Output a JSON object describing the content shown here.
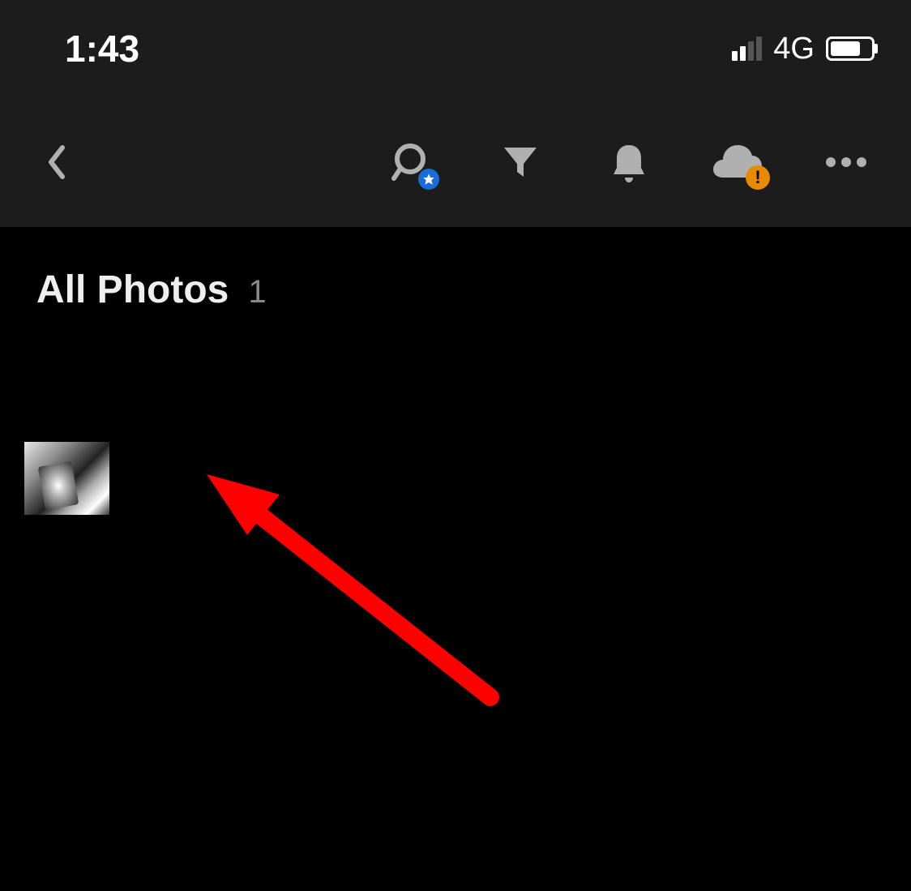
{
  "status": {
    "time": "1:43",
    "network_type": "4G"
  },
  "toolbar": {
    "icons": {
      "back": "back-icon",
      "search": "search-icon",
      "filter": "filter-icon",
      "bell": "bell-icon",
      "cloud": "cloud-icon",
      "more": "more-icon"
    }
  },
  "main": {
    "title": "All Photos",
    "count": "1"
  }
}
